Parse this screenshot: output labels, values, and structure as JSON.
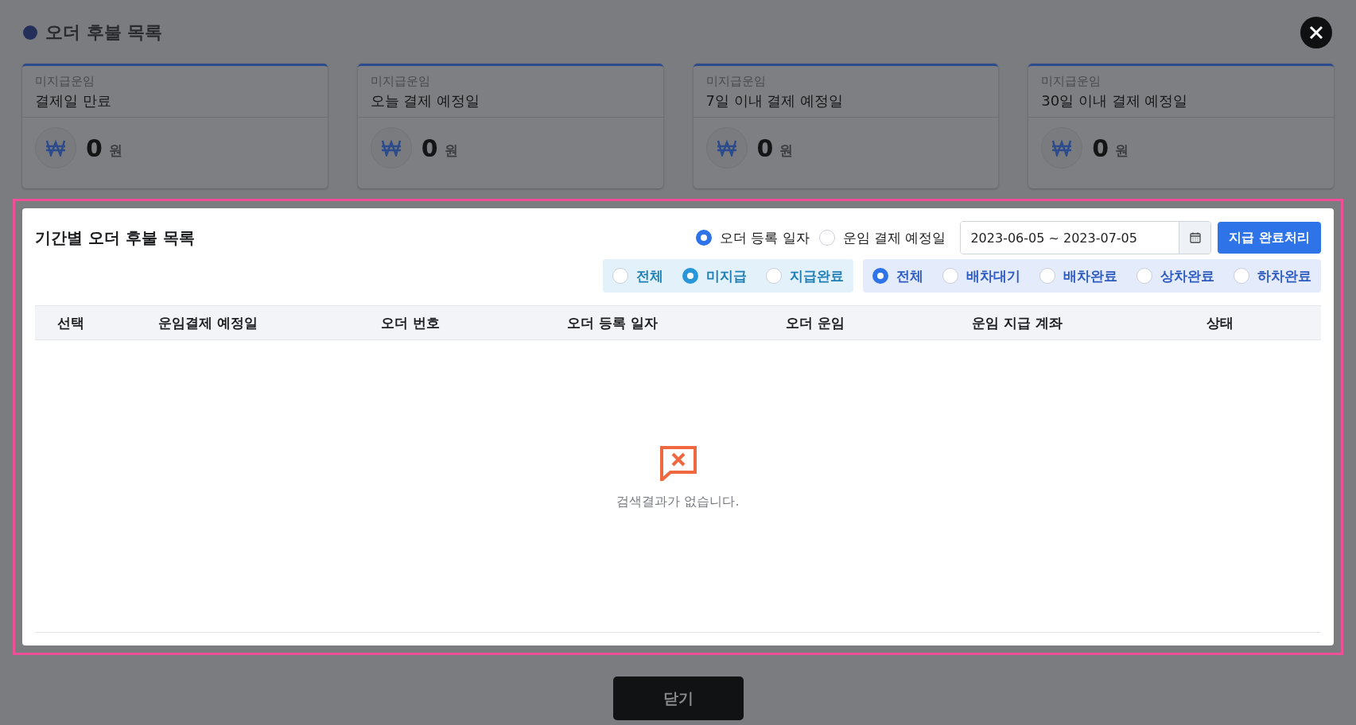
{
  "title": "오더 후불 목록",
  "cards": [
    {
      "caption": "미지급운임",
      "label": "결제일 만료",
      "amount": "0",
      "unit": "원"
    },
    {
      "caption": "미지급운임",
      "label": "오늘 결제 예정일",
      "amount": "0",
      "unit": "원"
    },
    {
      "caption": "미지급운임",
      "label": "7일 이내 결제 예정일",
      "amount": "0",
      "unit": "원"
    },
    {
      "caption": "미지급운임",
      "label": "30일 이내 결제 예정일",
      "amount": "0",
      "unit": "원"
    }
  ],
  "panel": {
    "title": "기간별 오더 후불 목록",
    "date_basis": [
      {
        "label": "오더 등록 일자",
        "selected": true
      },
      {
        "label": "운임 결제 예정일",
        "selected": false
      }
    ],
    "date_range": "2023-06-05 ~ 2023-07-05",
    "action_button": "지급 완료처리",
    "payment_filter": [
      {
        "label": "전체",
        "selected": false
      },
      {
        "label": "미지급",
        "selected": true
      },
      {
        "label": "지급완료",
        "selected": false
      }
    ],
    "status_filter": [
      {
        "label": "전체",
        "selected": true
      },
      {
        "label": "배차대기",
        "selected": false
      },
      {
        "label": "배차완료",
        "selected": false
      },
      {
        "label": "상차완료",
        "selected": false
      },
      {
        "label": "하차완료",
        "selected": false
      }
    ],
    "table": {
      "columns": [
        "선택",
        "운임결제 예정일",
        "오더 번호",
        "오더 등록 일자",
        "오더 운임",
        "운임 지급 계좌",
        "상태"
      ],
      "empty_message": "검색결과가 없습니다."
    }
  },
  "footer_button": "닫기"
}
